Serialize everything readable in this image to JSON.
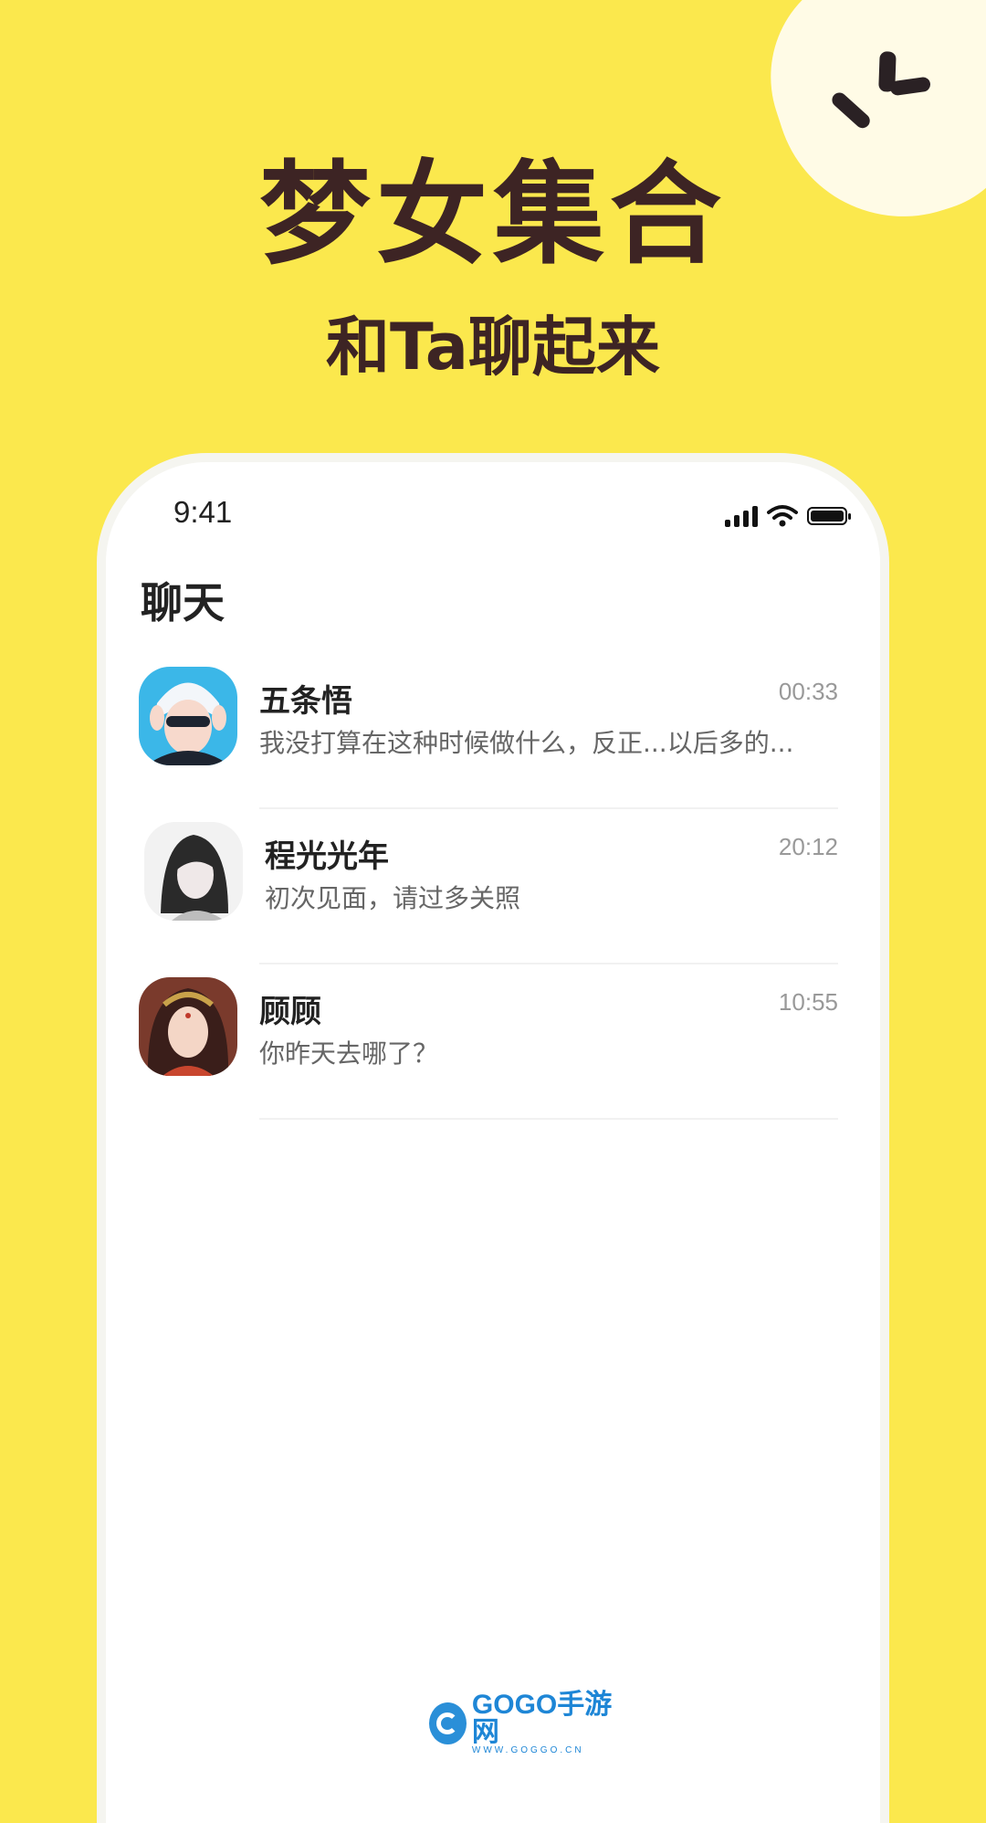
{
  "promo": {
    "headline": "梦女集合",
    "subheadline": "和Ta聊起来"
  },
  "status_bar": {
    "time": "9:41",
    "icons": [
      "signal-icon",
      "wifi-icon",
      "battery-icon"
    ]
  },
  "page": {
    "title": "聊天"
  },
  "chats": [
    {
      "name": "五条悟",
      "time": "00:33",
      "message": "我没打算在这种时候做什么，反正...以后多的...",
      "avatar": "avatar-gojo"
    },
    {
      "name": "程光光年",
      "time": "20:12",
      "message": "初次见面，请过多关照",
      "avatar": "avatar-cheng"
    },
    {
      "name": "顾顾",
      "time": "10:55",
      "message": "你昨天去哪了？",
      "avatar": "avatar-gugu"
    }
  ],
  "watermark": {
    "brand": "GOGO手游网",
    "url": "WWW.GOGGO.CN"
  },
  "colors": {
    "background": "#FBE84D",
    "headline": "#3D2424",
    "card": "#FFFFFF"
  }
}
